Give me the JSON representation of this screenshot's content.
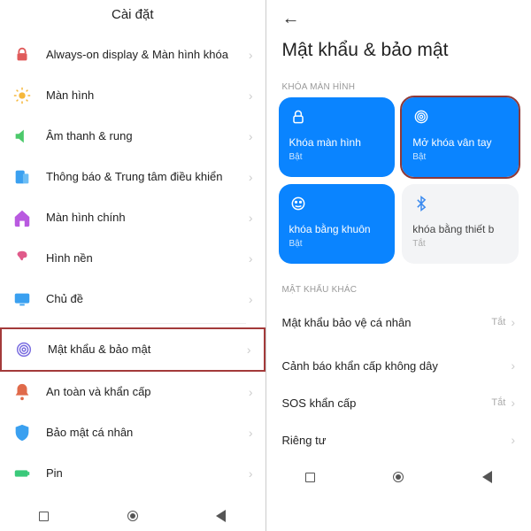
{
  "colors": {
    "accent": "#0a84ff",
    "highlight_border": "#a33a3a"
  },
  "left": {
    "title": "Cài đặt",
    "items": [
      {
        "label": "Always-on display & Màn hình khóa",
        "icon": "lock-icon",
        "color": "#e05a5a"
      },
      {
        "label": "Màn hình",
        "icon": "sun-icon",
        "color": "#f5b73a"
      },
      {
        "label": "Âm thanh & rung",
        "icon": "sound-icon",
        "color": "#4cc96b"
      },
      {
        "label": "Thông báo & Trung tâm điều khiển",
        "icon": "notification-icon",
        "color": "#3aa0f0"
      },
      {
        "label": "Màn hình chính",
        "icon": "home-icon",
        "color": "#b95ae0"
      },
      {
        "label": "Hình nền",
        "icon": "wallpaper-icon",
        "color": "#e05a8a"
      },
      {
        "label": "Chủ đề",
        "icon": "theme-icon",
        "color": "#3aa0f0"
      }
    ],
    "items2": [
      {
        "label": "Mật khẩu & bảo mật",
        "icon": "fingerprint-icon",
        "color": "#7a6de0",
        "highlight": true
      },
      {
        "label": "An toàn và khẩn cấp",
        "icon": "bell-icon",
        "color": "#e06a4a"
      },
      {
        "label": "Bảo mật cá nhân",
        "icon": "shield-icon",
        "color": "#3aa0f0"
      },
      {
        "label": "Pin",
        "icon": "battery-icon",
        "color": "#3ac97a"
      }
    ]
  },
  "right": {
    "title": "Mật khẩu & bảo mật",
    "section1_label": "KHÓA MÀN HÌNH",
    "tiles": [
      {
        "label": "Khóa màn hình",
        "status": "Bật",
        "icon": "padlock-icon",
        "style": "blue"
      },
      {
        "label": "Mở khóa vân tay",
        "status": "Bật",
        "icon": "fingerprint-icon",
        "style": "blue",
        "highlight": true
      },
      {
        "label": "khóa bằng khuôn",
        "status": "Bật",
        "icon": "face-icon",
        "style": "blue"
      },
      {
        "label": "khóa bằng thiết b",
        "status": "Tắt",
        "icon": "bluetooth-icon",
        "style": "gray"
      }
    ],
    "section2_label": "MẬT KHẨU KHÁC",
    "rows": [
      {
        "label": "Mật khẩu bảo vệ cá nhân",
        "status": "Tắt"
      },
      {
        "label": "Cảnh báo khẩn cấp không dây",
        "status": ""
      },
      {
        "label": "SOS khẩn cấp",
        "status": "Tắt"
      },
      {
        "label": "Riêng tư",
        "status": ""
      }
    ]
  }
}
